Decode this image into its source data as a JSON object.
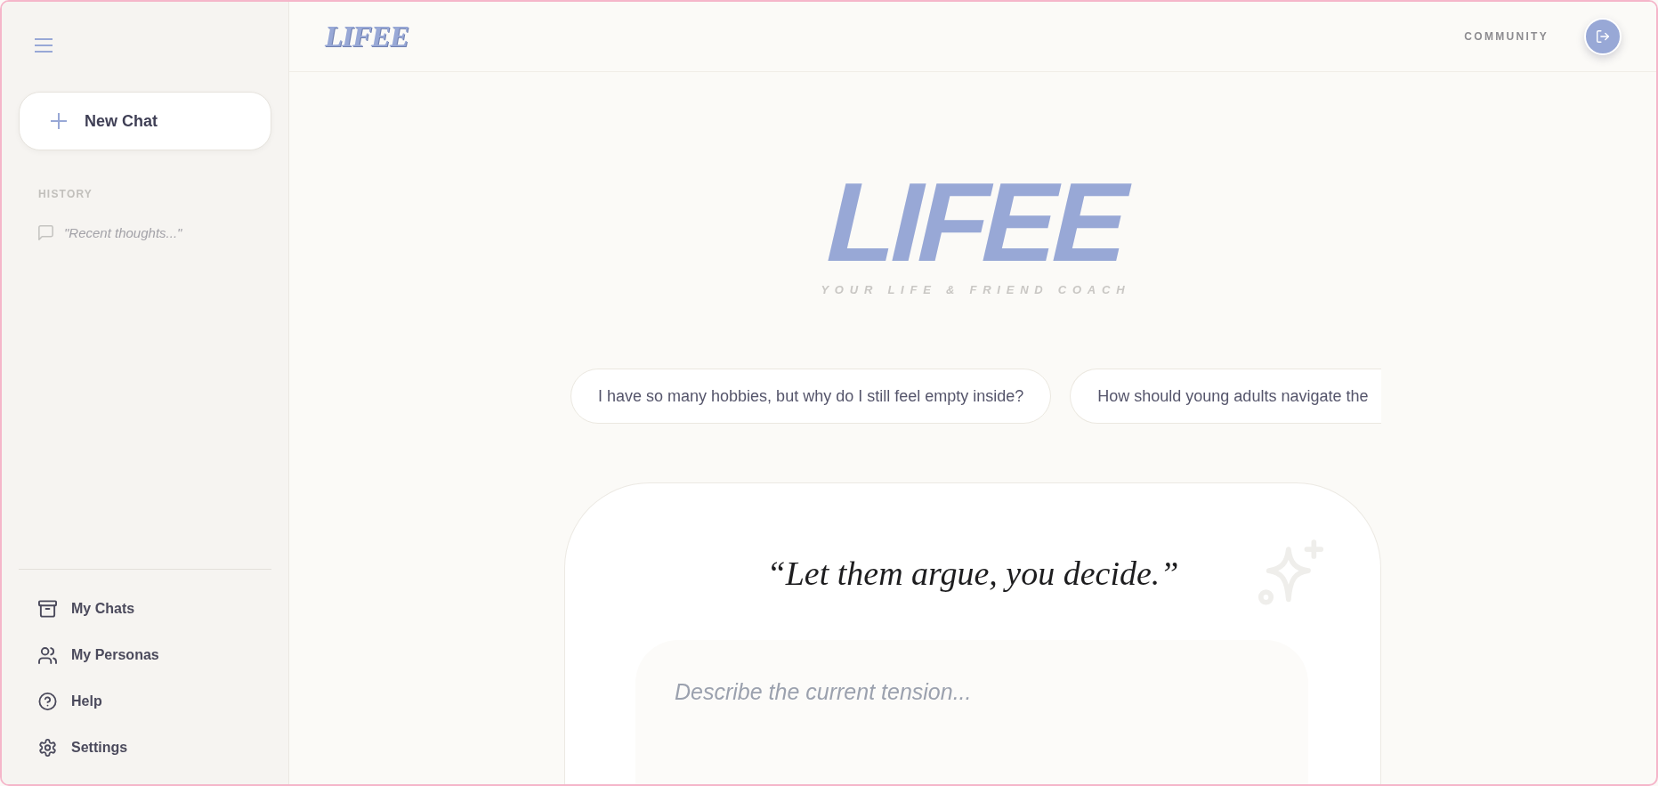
{
  "sidebar": {
    "new_chat_button": "New Chat",
    "history_heading": "HISTORY",
    "history": [
      {
        "title": "\"Recent thoughts...\""
      }
    ],
    "nav_items": [
      {
        "label": "My Chats"
      },
      {
        "label": "My Personas"
      },
      {
        "label": "Help"
      },
      {
        "label": "Settings"
      }
    ]
  },
  "header": {
    "logo": "LIFEE",
    "links": [
      {
        "label": "COMMUNITY"
      }
    ]
  },
  "hero": {
    "title": "LIFEE",
    "tagline": "YOUR LIFE & FRIEND COACH"
  },
  "suggestions": [
    {
      "text": "I have so many hobbies, but why do I still feel empty inside?",
      "cut_off": false
    },
    {
      "text": "How should young adults navigate the",
      "cut_off": true
    }
  ],
  "composer": {
    "quote": "“Let them argue, you decide.”",
    "placeholder": "Describe the current tension..."
  }
}
